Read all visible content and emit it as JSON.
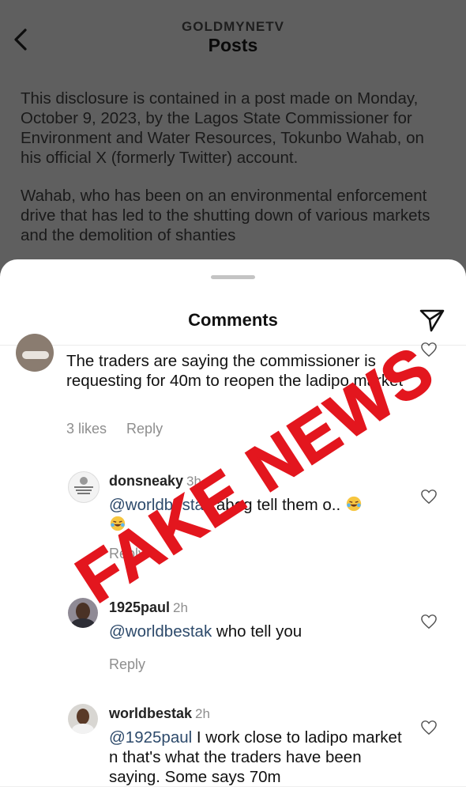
{
  "header": {
    "account": "GOLDMYNETV",
    "title": "Posts"
  },
  "article": {
    "paragraph1": "This disclosure is contained in a post made on Monday, October 9, 2023, by the Lagos State Commissioner for Environment and Water Resources, Tokunbo Wahab, on his official X (formerly Twitter) account.",
    "paragraph2": "Wahab, who has been on an environmental enforcement drive that has led to the shutting down of various markets and the demolition of shanties"
  },
  "comments_sheet": {
    "title": "Comments",
    "top_comment": {
      "text": "The traders are saying the commissioner is requesting for 40m to reopen the ladipo market",
      "likes": "3 likes",
      "reply": "Reply"
    },
    "replies": [
      {
        "user": "donsneaky",
        "time": "3h",
        "mention": "@worldbestak",
        "text": " abeg tell them o..",
        "reply": "Reply",
        "emoji": "laughing-tears"
      },
      {
        "user": "1925paul",
        "time": "2h",
        "mention": "@worldbestak",
        "text": " who tell you",
        "reply": "Reply"
      },
      {
        "user": "worldbestak",
        "time": "2h",
        "mention": "@1925paul",
        "text": " I work close to ladipo market n that's what the traders have been saying. Some says 70m"
      }
    ]
  },
  "stamp": {
    "text": "FAKE NEWS",
    "color": "#e3161e"
  },
  "colors": {
    "overlay": "#5f5f5f",
    "sheet": "#ffffff",
    "mention": "#2d4a6b",
    "muted": "#8e8e8e"
  }
}
